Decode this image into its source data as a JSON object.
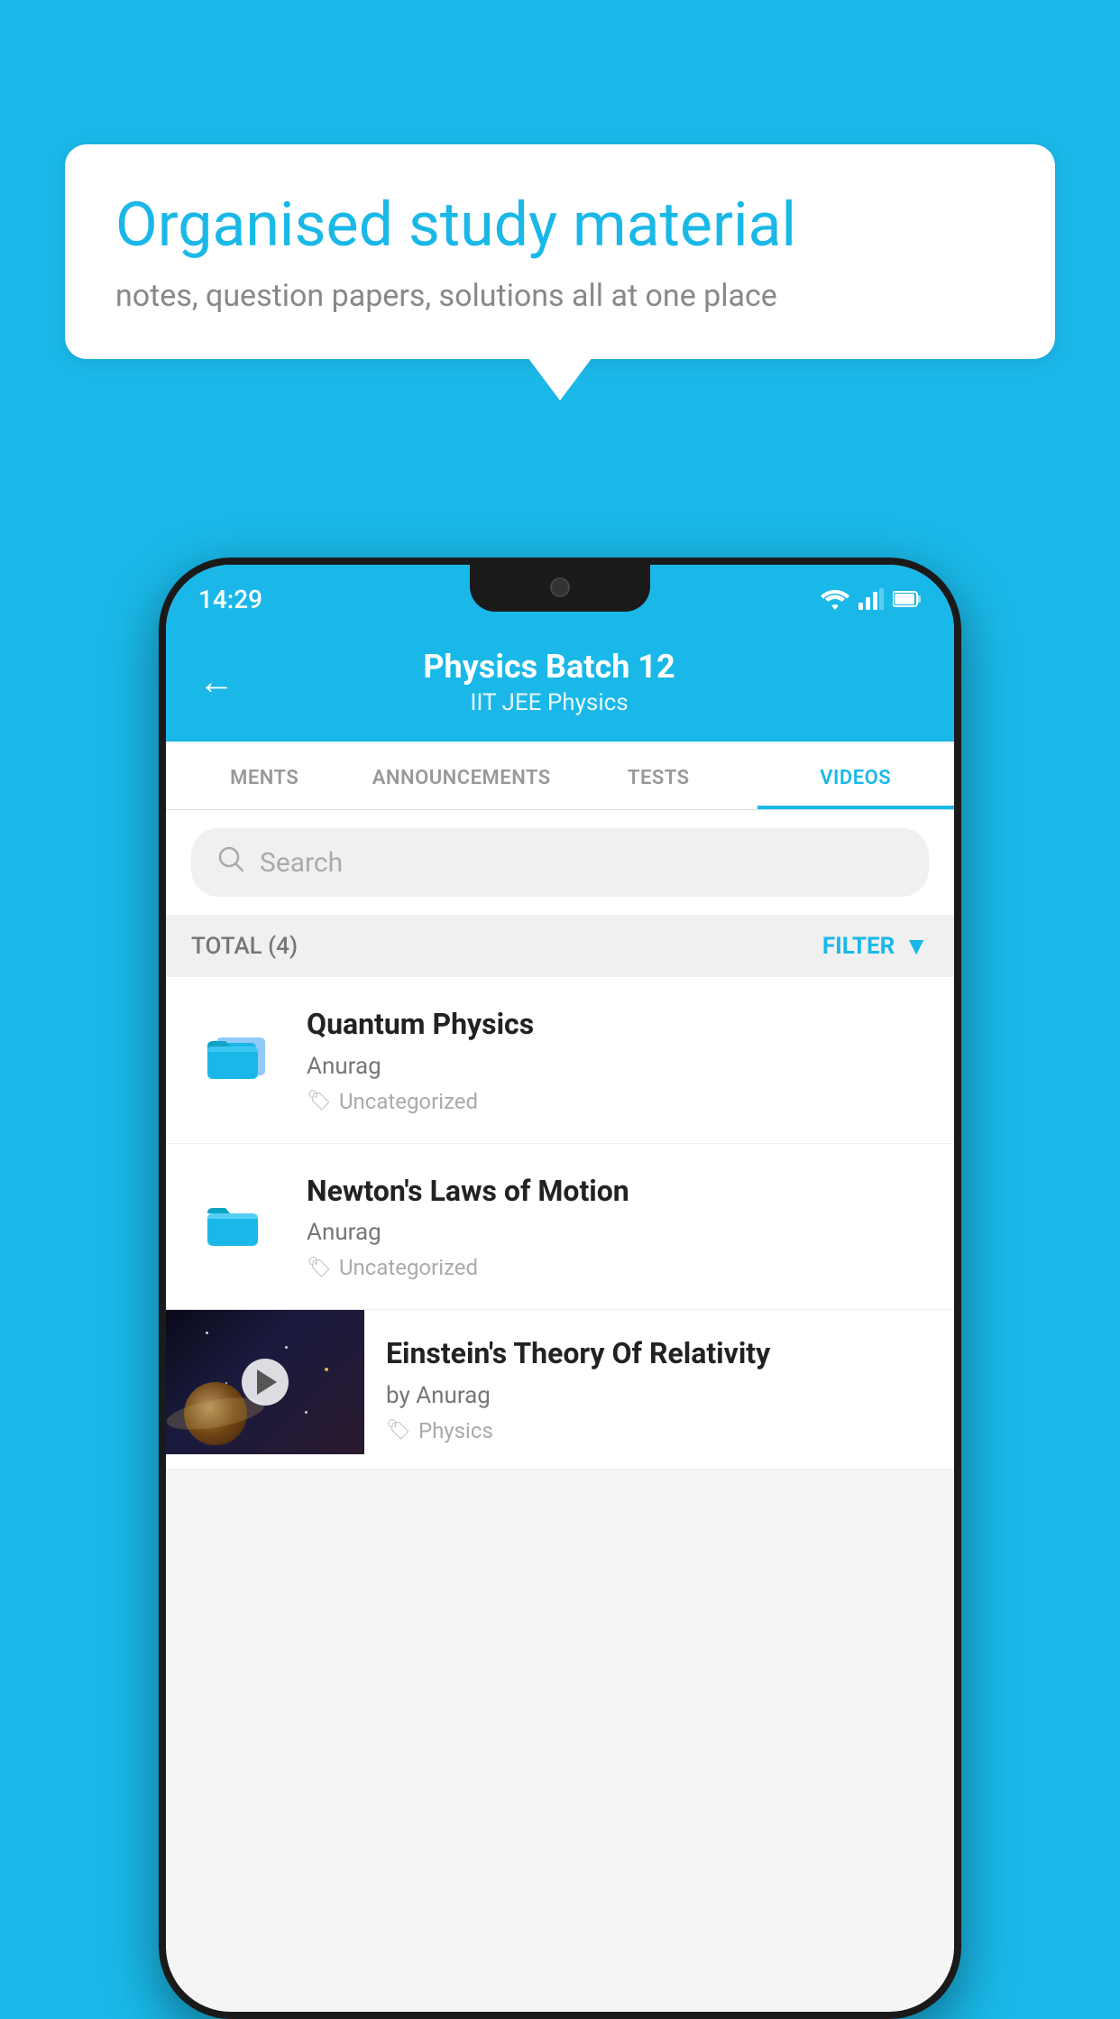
{
  "bubble": {
    "title": "Organised study material",
    "subtitle": "notes, question papers, solutions all at one place"
  },
  "status_bar": {
    "time": "14:29",
    "icons": [
      "wifi",
      "signal",
      "battery"
    ]
  },
  "header": {
    "title": "Physics Batch 12",
    "subtitle": "IIT JEE   Physics",
    "back_label": "←"
  },
  "tabs": [
    {
      "label": "MENTS",
      "active": false
    },
    {
      "label": "ANNOUNCEMENTS",
      "active": false
    },
    {
      "label": "TESTS",
      "active": false
    },
    {
      "label": "VIDEOS",
      "active": true
    }
  ],
  "search": {
    "placeholder": "Search"
  },
  "filter": {
    "total_label": "TOTAL (4)",
    "button_label": "FILTER"
  },
  "videos": [
    {
      "id": 1,
      "title": "Quantum Physics",
      "author": "Anurag",
      "tag": "Uncategorized",
      "type": "folder",
      "has_thumbnail": false
    },
    {
      "id": 2,
      "title": "Newton's Laws of Motion",
      "author": "Anurag",
      "tag": "Uncategorized",
      "type": "folder",
      "has_thumbnail": false
    },
    {
      "id": 3,
      "title": "Einstein's Theory Of Relativity",
      "author": "by Anurag",
      "tag": "Physics",
      "type": "video",
      "has_thumbnail": true
    }
  ]
}
